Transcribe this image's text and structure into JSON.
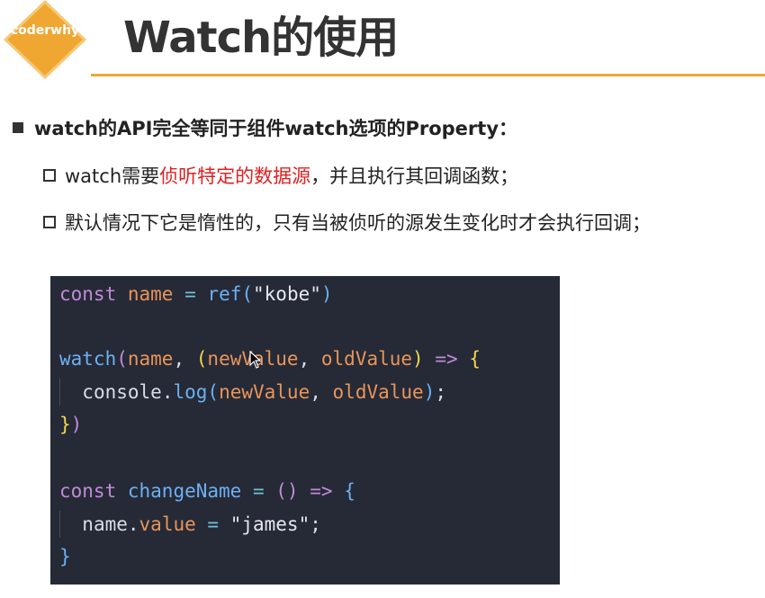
{
  "logo": {
    "text": "coderwhy",
    "color": "#f0a732"
  },
  "title": "Watch的使用",
  "bullets": {
    "main": "watch的API完全等同于组件watch选项的Property：",
    "sub1_a": "watch需要",
    "sub1_red": "侦听特定的数据源",
    "sub1_b": "，并且执行其回调函数；",
    "sub2": "默认情况下它是惰性的，只有当被侦听的源发生变化时才会执行回调；"
  },
  "code": {
    "l1": {
      "kw": "const",
      "var": "name",
      "eq": "=",
      "fn": "ref",
      "open": "(",
      "str": "\"kobe\"",
      "close": ")"
    },
    "l2": {
      "fn": "watch",
      "open": "(",
      "arg1": "name",
      "comma1": ",",
      "popen": "(",
      "p1": "newValue",
      "comma2": ",",
      "p2": "oldValue",
      "pclose": ")",
      "arrow": "=>",
      "brace": "{"
    },
    "l3": {
      "obj": "console",
      "dot": ".",
      "fn": "log",
      "open": "(",
      "a1": "newValue",
      "comma": ",",
      "a2": "oldValue",
      "close": ")",
      "semi": ";"
    },
    "l4": {
      "brace": "}",
      "paren": ")"
    },
    "l5": {
      "kw": "const",
      "var": "changeName",
      "eq": "=",
      "parens": "()",
      "arrow": "=>",
      "brace": "{"
    },
    "l6": {
      "obj": "name",
      "dot": ".",
      "prop": "value",
      "eq": "=",
      "str": "\"james\"",
      "semi": ";"
    },
    "l7": {
      "brace": "}"
    }
  },
  "colors": {
    "accent": "#f0a732",
    "highlight_red": "#e02020",
    "code_background": "#262a36"
  }
}
